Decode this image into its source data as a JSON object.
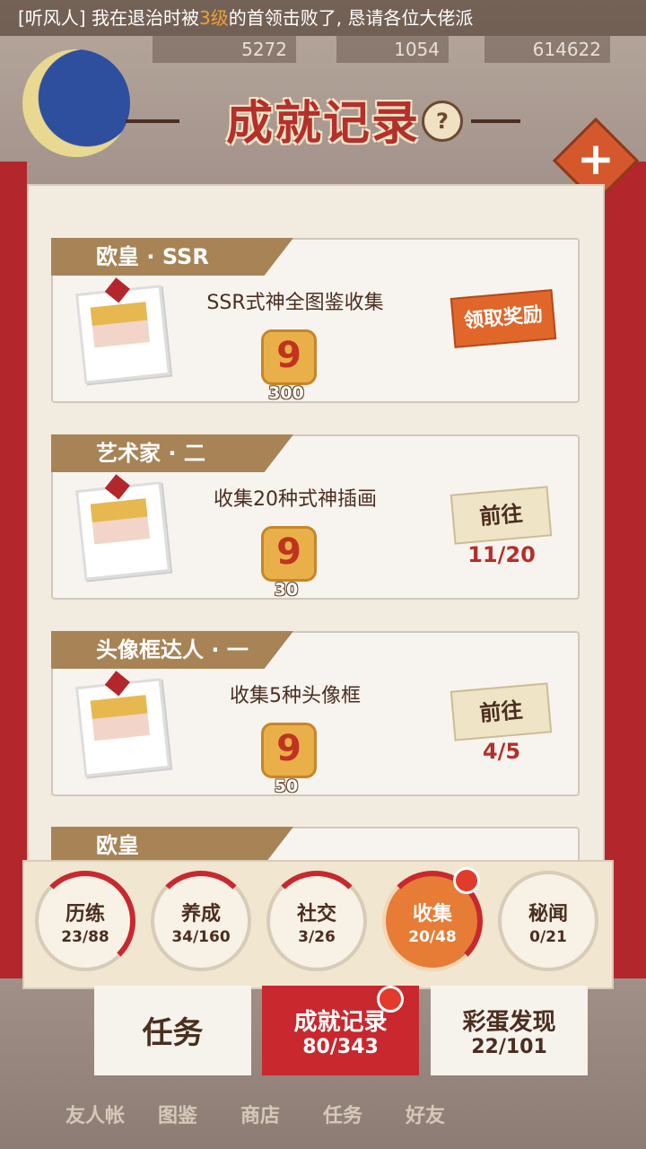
{
  "marquee": {
    "prefix": "[听风人] 我在退治时被",
    "highlight": "3级",
    "suffix": "的首领击败了, 恳请各位大佬派"
  },
  "resources": {
    "r1": "5272",
    "r2": "1054",
    "r3": "614622"
  },
  "title": "成就记录",
  "help": "?",
  "close": "+",
  "cards": [
    {
      "header": "欧皇 · SSR",
      "desc": "SSR式神全图鉴收集",
      "reward": "300",
      "action": "领取奖励",
      "progress": ""
    },
    {
      "header": "艺术家 · 二",
      "desc": "收集20种式神插画",
      "reward": "30",
      "action": "前往",
      "progress": "11/20"
    },
    {
      "header": "头像框达人 · 一",
      "desc": "收集5种头像框",
      "reward": "50",
      "action": "前往",
      "progress": "4/5"
    },
    {
      "header": "欧皇"
    }
  ],
  "categories": [
    {
      "name": "历练",
      "count": "23/88"
    },
    {
      "name": "养成",
      "count": "34/160"
    },
    {
      "name": "社交",
      "count": "3/26"
    },
    {
      "name": "收集",
      "count": "20/48"
    },
    {
      "name": "秘闻",
      "count": "0/21"
    }
  ],
  "bottom_tabs": {
    "task": "任务",
    "achievement": {
      "label": "成就记录",
      "count": "80/343"
    },
    "easter": {
      "label": "彩蛋发现",
      "count": "22/101"
    }
  },
  "dock": [
    "友人帐",
    "图鉴",
    "商店",
    "任务",
    "好友"
  ],
  "colors": {
    "accent": "#b4302a",
    "claim": "#e0662a",
    "active_tab": "#c8282e"
  }
}
